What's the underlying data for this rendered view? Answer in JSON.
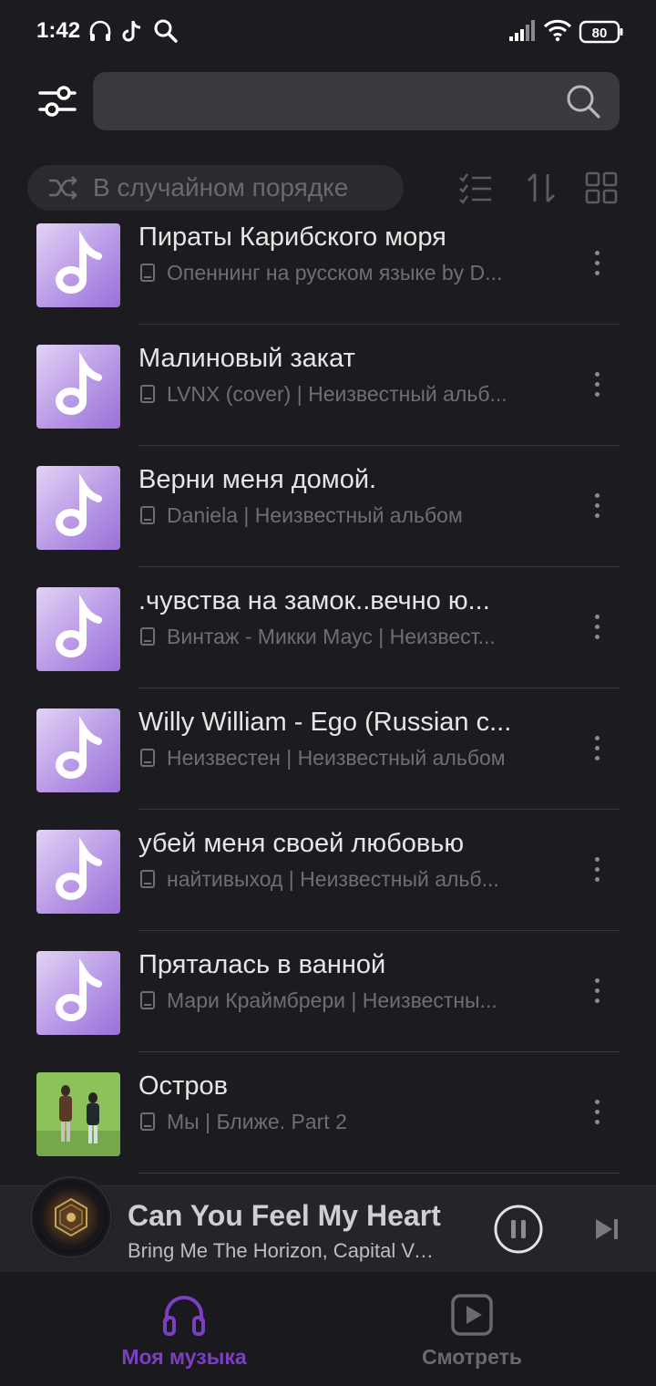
{
  "status_bar": {
    "time": "1:42",
    "battery": "80"
  },
  "search": {
    "placeholder": ""
  },
  "controls": {
    "shuffle_label": "В случайном порядке"
  },
  "tracks": [
    {
      "title": "Пираты Карибского моря",
      "subtitle": "Опеннинг на русском языке by D...",
      "art": "music-note"
    },
    {
      "title": "Малиновый закат",
      "subtitle": "LVNX (cover) | Неизвестный альб...",
      "art": "music-note"
    },
    {
      "title": "Верни меня домой.",
      "subtitle": "Daniela | Неизвестный альбом",
      "art": "music-note"
    },
    {
      "title": ".чувства на замок..вечно ю...",
      "subtitle": "Винтаж - Микки Маус | Неизвест...",
      "art": "music-note"
    },
    {
      "title": "Willy William - Ego (Russian c...",
      "subtitle": "Неизвестен | Неизвестный альбом",
      "art": "music-note"
    },
    {
      "title": "убей меня своей любовью",
      "subtitle": "найтивыход | Неизвестный альб...",
      "art": "music-note"
    },
    {
      "title": "Пряталась в ванной",
      "subtitle": "Мари Краймбрери | Неизвестны...",
      "art": "music-note"
    },
    {
      "title": "Остров",
      "subtitle": "Мы | Ближе. Part 2",
      "art": "photo"
    }
  ],
  "player": {
    "title": "Can You Feel My Heart",
    "artist": "Bring Me The Horizon, Capital Voi..."
  },
  "nav": [
    {
      "label": "Моя музыка",
      "icon": "headphones-icon",
      "active": true
    },
    {
      "label": "Смотреть",
      "icon": "play-video-icon",
      "active": false
    }
  ],
  "colors": {
    "background": "#1c1b1f",
    "accent": "#7b3fc4",
    "art_gradient_start": "#e3d2f5",
    "art_gradient_end": "#9a70d8"
  }
}
